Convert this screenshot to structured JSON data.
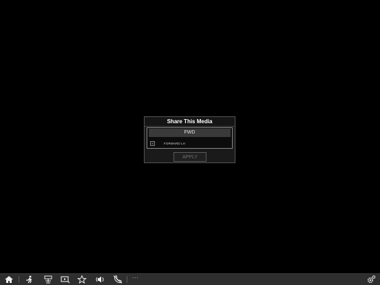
{
  "dialog": {
    "title": "Share This Media",
    "group_header": "FWD",
    "items": [
      {
        "label": "FORWARD LH",
        "checked": false
      }
    ],
    "apply_label": "APPLY"
  },
  "taskbar": {
    "icons": [
      "home-icon",
      "person-walk-icon",
      "sign-icon",
      "video-icon",
      "star-icon",
      "audio-icon",
      "phone-disabled-icon",
      "settings-icon"
    ],
    "more_label": "···"
  },
  "colors": {
    "background": "#000000",
    "dialog": "#1a1a1a",
    "taskbar": "#2e2e2e",
    "apply_text": "#6f6f6f"
  }
}
